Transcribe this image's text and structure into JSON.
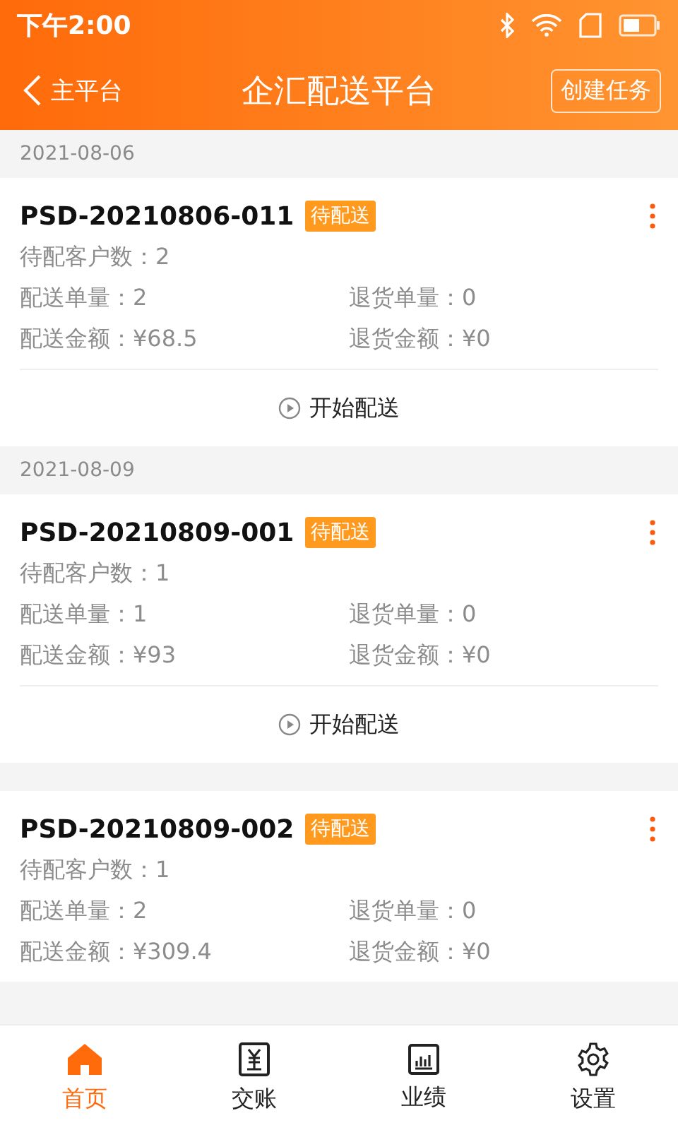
{
  "status_bar": {
    "time": "下午2:00"
  },
  "header": {
    "back_label": "主平台",
    "title": "企汇配送平台",
    "action": "创建任务"
  },
  "sections": [
    {
      "date": "2021-08-06",
      "card": {
        "id": "PSD-20210806-011",
        "status": "待配送",
        "customers": "待配客户数：2",
        "stats": [
          "配送单量：2",
          "退货单量：0",
          "配送金额：¥68.5",
          "退货金额：¥0"
        ],
        "action": "开始配送"
      }
    },
    {
      "date": "2021-08-09",
      "card": {
        "id": "PSD-20210809-001",
        "status": "待配送",
        "customers": "待配客户数：1",
        "stats": [
          "配送单量：1",
          "退货单量：0",
          "配送金额：¥93",
          "退货金额：¥0"
        ],
        "action": "开始配送"
      }
    },
    {
      "card": {
        "id": "PSD-20210809-002",
        "status": "待配送",
        "customers": "待配客户数：1",
        "stats": [
          "配送单量：2",
          "退货单量：0",
          "配送金额：¥309.4",
          "退货金额：¥0"
        ]
      }
    }
  ],
  "nav": {
    "items": [
      {
        "label": "首页",
        "selected": true
      },
      {
        "label": "交账",
        "selected": false
      },
      {
        "label": "业绩",
        "selected": false
      },
      {
        "label": "设置",
        "selected": false
      }
    ]
  }
}
